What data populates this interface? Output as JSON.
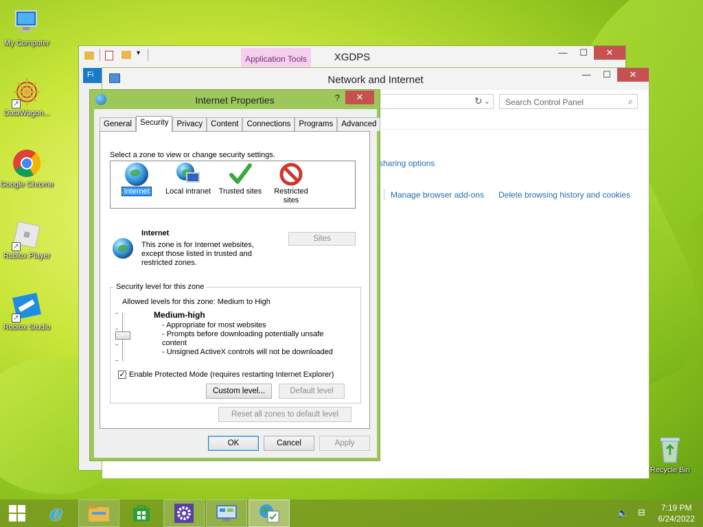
{
  "desktop": {
    "icons": [
      {
        "label": "My Computer",
        "icon": "computer-icon"
      },
      {
        "label": "DataWagon...",
        "icon": "datawagon-icon"
      },
      {
        "label": "Google Chrome",
        "icon": "chrome-icon"
      },
      {
        "label": "Roblox Player",
        "icon": "roblox-player-icon"
      },
      {
        "label": "Roblox Studio",
        "icon": "roblox-studio-icon"
      },
      {
        "label": "Recycle Bin",
        "icon": "recycle-bin-icon"
      }
    ]
  },
  "explorer_window": {
    "title": "XGDPS",
    "contextual_tab": "Application Tools",
    "file_tab": "Fi"
  },
  "control_panel": {
    "title": "Network and Internet",
    "search_placeholder": "Search Control Panel",
    "links": {
      "sharing_options": "sharing options",
      "manage_addons": "Manage browser add-ons",
      "delete_history": "Delete browsing history and cookies"
    }
  },
  "dialog": {
    "title": "Internet Properties",
    "help": "?",
    "tabs": [
      "General",
      "Security",
      "Privacy",
      "Content",
      "Connections",
      "Programs",
      "Advanced"
    ],
    "active_tab": "Security",
    "zone_prompt": "Select a zone to view or change security settings.",
    "zones": [
      {
        "label": "Internet",
        "icon": "globe-icon",
        "selected": true
      },
      {
        "label": "Local intranet",
        "icon": "intranet-icon",
        "selected": false
      },
      {
        "label": "Trusted sites",
        "icon": "checkmark-icon",
        "selected": false
      },
      {
        "label": "Restricted sites",
        "icon": "restricted-icon",
        "selected": false
      }
    ],
    "zone_name": "Internet",
    "zone_description": "This zone is for Internet websites, except those listed in trusted and restricted zones.",
    "sites_button": "Sites",
    "security_group_label": "Security level for this zone",
    "allowed_levels": "Allowed levels for this zone: Medium to High",
    "level_name": "Medium-high",
    "level_bullets": [
      "- Appropriate for most websites",
      "- Prompts before downloading potentially unsafe content",
      "- Unsigned ActiveX controls will not be downloaded"
    ],
    "protected_mode": {
      "label": "Enable Protected Mode (requires restarting Internet Explorer)",
      "checked": true
    },
    "custom_level_button": "Custom level...",
    "default_level_button": "Default level",
    "reset_all_button": "Reset all zones to default level",
    "ok_button": "OK",
    "cancel_button": "Cancel",
    "apply_button": "Apply"
  },
  "taskbar": {
    "items": [
      "start-icon",
      "internet-explorer-icon",
      "file-explorer-icon",
      "store-icon",
      "settings-icon",
      "control-panel-icon",
      "internet-properties-icon"
    ],
    "time": "7:19 PM",
    "date": "6/24/2022"
  },
  "colors": {
    "accent_green": "#9dc75a",
    "close_red": "#c75050",
    "link_blue": "#1e6db6",
    "selection_blue": "#3399ff"
  }
}
